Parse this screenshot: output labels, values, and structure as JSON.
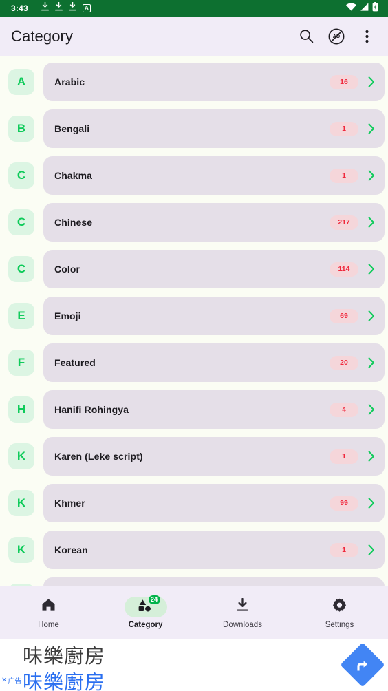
{
  "statusbar": {
    "time": "3:43",
    "left_icons": [
      "download-icon",
      "download-icon",
      "download-icon",
      "letter-a-icon"
    ],
    "letter_a": "A",
    "right_icons": [
      "wifi-icon",
      "cellular-signal-icon",
      "battery-icon"
    ],
    "background": "#0d7030"
  },
  "appbar": {
    "title": "Category",
    "background": "#f1ecf7",
    "actions": [
      {
        "name": "search-icon",
        "label": "Search"
      },
      {
        "name": "remove-ads-icon",
        "label": "AD"
      },
      {
        "name": "overflow-menu-icon",
        "label": "More options"
      }
    ]
  },
  "colors": {
    "page_background": "#fbfdf4",
    "card_background": "#e5dfe8",
    "avatar_background": "#dcf5e3",
    "avatar_text": "#0ecb5a",
    "badge_background": "#f5d6da",
    "badge_text": "#f0283c",
    "chevron": "#0ecb5a",
    "accent_green": "#00b34a"
  },
  "categories": [
    {
      "initial": "A",
      "name": "Arabic",
      "count": "16"
    },
    {
      "initial": "B",
      "name": "Bengali",
      "count": "1"
    },
    {
      "initial": "C",
      "name": "Chakma",
      "count": "1"
    },
    {
      "initial": "C",
      "name": "Chinese",
      "count": "217"
    },
    {
      "initial": "C",
      "name": "Color",
      "count": "114"
    },
    {
      "initial": "E",
      "name": "Emoji",
      "count": "69"
    },
    {
      "initial": "F",
      "name": "Featured",
      "count": "20"
    },
    {
      "initial": "H",
      "name": "Hanifi Rohingya",
      "count": "4"
    },
    {
      "initial": "K",
      "name": "Karen (Leke script)",
      "count": "1"
    },
    {
      "initial": "K",
      "name": "Khmer",
      "count": "99"
    },
    {
      "initial": "K",
      "name": "Korean",
      "count": "1"
    }
  ],
  "bottomnav": {
    "items": [
      {
        "label": "Home",
        "icon": "home-icon",
        "active": false,
        "badge": ""
      },
      {
        "label": "Category",
        "icon": "shapes-icon",
        "active": true,
        "badge": "24"
      },
      {
        "label": "Downloads",
        "icon": "download-icon",
        "active": false,
        "badge": ""
      },
      {
        "label": "Settings",
        "icon": "gear-icon",
        "active": false,
        "badge": ""
      }
    ]
  },
  "ad": {
    "headline": "味樂廚房",
    "link_text": "味樂廚房",
    "close_label": "✕",
    "ad_label": "广告",
    "cta_icon": "turn-right-arrow-icon"
  }
}
